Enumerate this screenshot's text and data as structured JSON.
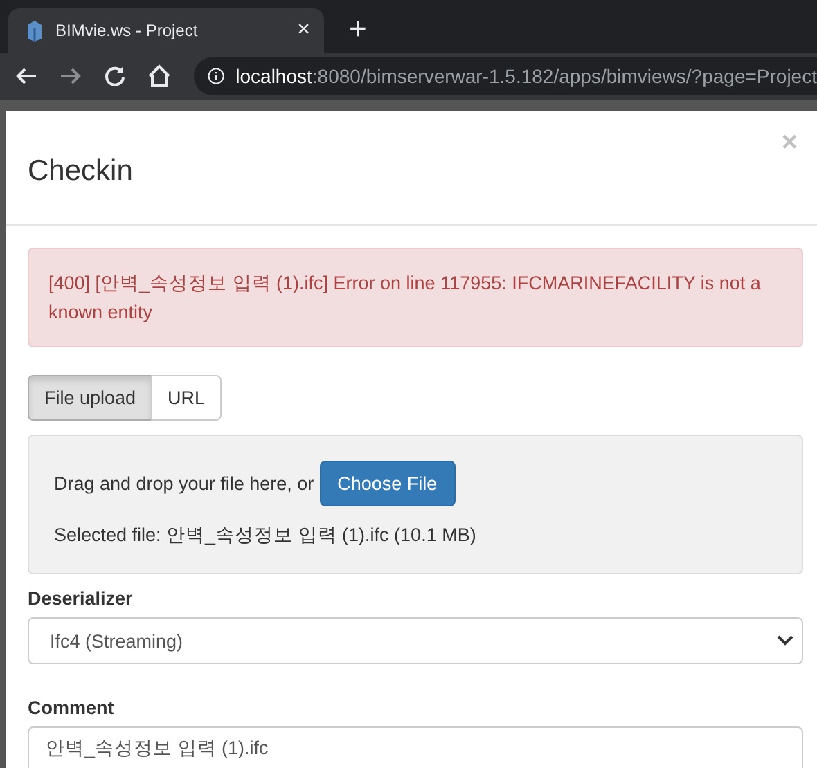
{
  "browser": {
    "tab_title": "BIMvie.ws - Project",
    "tab_close": "×",
    "new_tab": "+",
    "url_host": "localhost",
    "url_path": ":8080/bimserverwar-1.5.182/apps/bimviews/?page=Project"
  },
  "dialog": {
    "title": "Checkin",
    "close": "×",
    "alert": "[400] [안벽_속성정보 입력 (1).ifc] Error on line 117955: IFCMARINEFACILITY is not a known entity",
    "tabs": [
      {
        "label": "File upload",
        "selected": true
      },
      {
        "label": "URL",
        "selected": false
      }
    ],
    "dropzone": {
      "prompt": "Drag and drop your file here, or",
      "button": "Choose File",
      "selected_file": "Selected file: 안벽_속성정보 입력 (1).ifc (10.1 MB)"
    },
    "deserializer": {
      "label": "Deserializer",
      "value": "Ifc4 (Streaming)"
    },
    "comment": {
      "label": "Comment",
      "value": "안벽_속성정보 입력 (1).ifc"
    }
  }
}
